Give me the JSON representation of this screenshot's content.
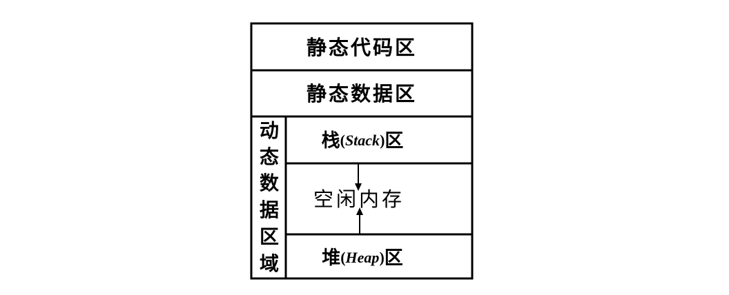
{
  "sections": {
    "static_code": "静态代码区",
    "static_data": "静态数据区",
    "dynamic_region_chars": [
      "动",
      "态",
      "数",
      "据",
      "区",
      "域"
    ],
    "stack": {
      "prefix": "栈",
      "open": "(",
      "latin": "Stack",
      "close": ")",
      "suffix": "区"
    },
    "free_memory": "空闲内存",
    "heap": {
      "prefix": "堆 ",
      "open": "(",
      "latin": "Heap",
      "close": ")",
      "suffix": "区"
    }
  }
}
